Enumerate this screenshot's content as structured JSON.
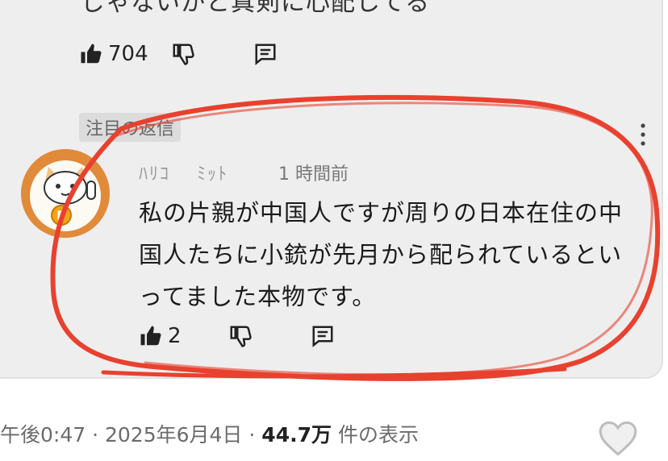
{
  "comment": {
    "text_partial": "じゃないかと真剣に心配してる",
    "likes": "704"
  },
  "reply": {
    "badge": "注目の返信",
    "username": "ﾊﾘｺ　 ﾐｯﾄ",
    "time": "1 時間前",
    "line1": "私の片親が中国人ですが周りの日本在住の中",
    "line2": "国人たちに小銃が先月から配られているとい",
    "line3": "ってました本物です。",
    "likes": "2"
  },
  "post_meta": {
    "time": "午後0:47",
    "date": "2025年6月4日",
    "views_count": "44.7万",
    "views_label": "件の表示",
    "sep": "·"
  },
  "colors": {
    "annotation": "#e8412f",
    "card": "#eeeeee",
    "avatar": "#e08a3a"
  },
  "icons": [
    "like-icon",
    "dislike-icon",
    "reply-icon",
    "more-vert-icon",
    "heart-icon"
  ]
}
